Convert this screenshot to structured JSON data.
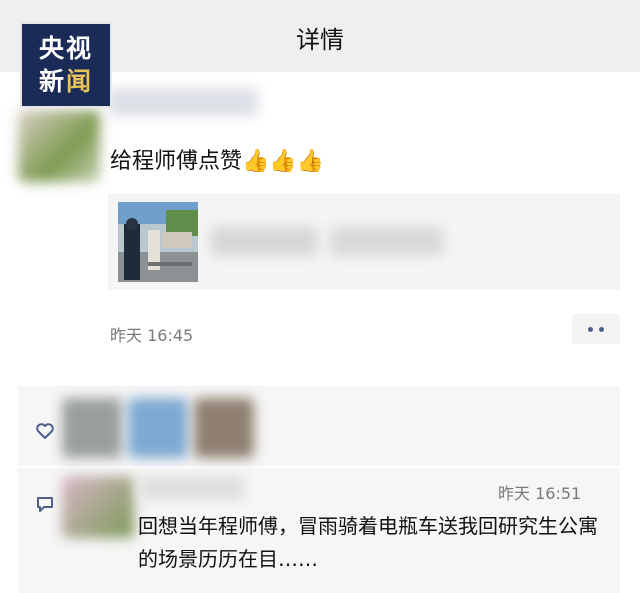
{
  "header": {
    "title": "详情"
  },
  "watermark": {
    "line1": "央视",
    "line2_part1": "新",
    "line2_part2": "闻"
  },
  "post": {
    "text": "给程师傅点赞👍👍👍",
    "time": "昨天 16:45"
  },
  "comment": {
    "time": "昨天 16:51",
    "text": "回想当年程师傅，冒雨骑着电瓶车送我回研究生公寓的场景历历在目……"
  },
  "colors": {
    "accent": "#4c5f8b",
    "logo_bg": "#1b2b57",
    "logo_accent": "#e8c35a"
  },
  "icons": {
    "like": "heart-icon",
    "comment": "comment-icon",
    "more": "more-dots-icon"
  }
}
